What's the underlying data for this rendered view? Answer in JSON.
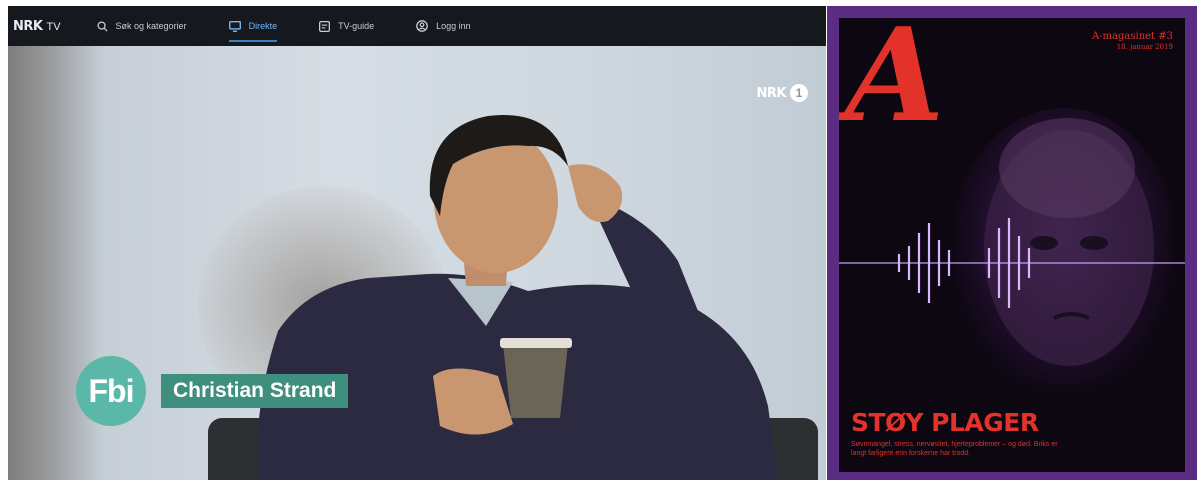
{
  "tv": {
    "logo": {
      "brand": "NRK",
      "product": "TV"
    },
    "nav": [
      {
        "label": "Søk og kategorier",
        "icon": "search-icon",
        "active": false
      },
      {
        "label": "Direkte",
        "icon": "tv-icon",
        "active": true
      },
      {
        "label": "TV-guide",
        "icon": "guide-icon",
        "active": false
      },
      {
        "label": "Logg inn",
        "icon": "user-icon",
        "active": false
      }
    ],
    "channel": {
      "brand": "NRK",
      "number": "1"
    },
    "program_badge": "Fbi",
    "caption": "Christian Strand",
    "colors": {
      "topbar": "#15181d",
      "active": "#6eb8ff",
      "badge": "#5bb8a8",
      "caption": "#3f8f7e"
    }
  },
  "magazine": {
    "brand_letter": "A",
    "issue": "A-magasinet #3",
    "date": "18. januar 2019",
    "headline": "STØY PLAGER",
    "subtitle": "Søvnmangel, stress, nervøsitet, hjerteproblemer – og død. Briks er langt farligere enn forskerne har trodd.",
    "colors": {
      "frame": "#5a2d82",
      "accent": "#e2322a"
    }
  }
}
